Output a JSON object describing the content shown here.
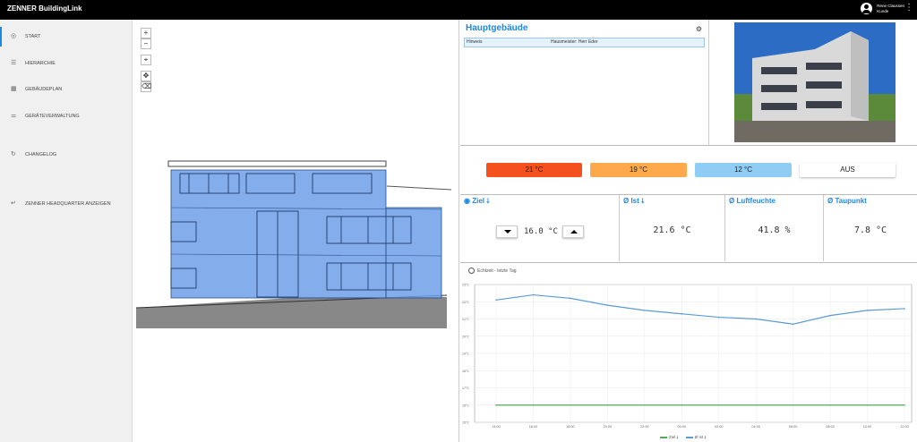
{
  "app": {
    "title": "ZENNER BuildingLink"
  },
  "user": {
    "name": "Rene Claussen",
    "role": "Kunde"
  },
  "sidebar": {
    "items": [
      {
        "label": "START",
        "icon": "dashboard-icon",
        "active": true
      },
      {
        "label": "HIERARCHIE",
        "icon": "hierarchy-icon"
      },
      {
        "label": "GEBÄUDEPLAN",
        "icon": "building-icon"
      },
      {
        "label": "GERÄTEVERWALTUNG",
        "icon": "sliders-icon"
      },
      {
        "label": "CHANGELOG",
        "icon": "history-icon"
      },
      {
        "label": "ZENNER HEADQUARTER ANZEIGEN",
        "icon": "return-icon"
      }
    ]
  },
  "map_controls": {
    "zoom_in": "+",
    "zoom_out": "−"
  },
  "building": {
    "title": "Hauptgebäude",
    "note_key": "Hinweis",
    "note_value": "Hausmeister: Herr Eder"
  },
  "temp_buttons": [
    {
      "label": "21 °C",
      "color": "#f4511e"
    },
    {
      "label": "19 °C",
      "color": "#ffa94d"
    },
    {
      "label": "12 °C",
      "color": "#90cdf4"
    },
    {
      "label": "AUS",
      "color": "#ffffff"
    }
  ],
  "kpis": {
    "ziel": {
      "title": "◉ Ziel ⭣",
      "value": "16.0 °C"
    },
    "ist": {
      "title": "Ø Ist ⭣",
      "value": "21.6 °C"
    },
    "feuchte": {
      "title": "Ø Luftfeuchte",
      "value": "41.8 %"
    },
    "taupunkt": {
      "title": "Ø Taupunkt",
      "value": "7.8 °C"
    }
  },
  "chart_label": "Echtzeit - letzte Tag",
  "chart_data": {
    "type": "line",
    "x": [
      "14:00",
      "16:00",
      "18:00",
      "20:00",
      "22:00",
      "00:00",
      "02:00",
      "04:00",
      "06:00",
      "08:00",
      "10:00",
      "12:00"
    ],
    "series": [
      {
        "name": "Ziel ⭣",
        "color": "#4caf50",
        "values": [
          16,
          16,
          16,
          16,
          16,
          16,
          16,
          16,
          16,
          16,
          16,
          16
        ]
      },
      {
        "name": "Ø Ist ⭣",
        "color": "#5b9bd5",
        "values": [
          22.1,
          22.4,
          22.2,
          21.8,
          21.5,
          21.3,
          21.1,
          21.0,
          20.7,
          21.2,
          21.5,
          21.6
        ]
      }
    ],
    "yticks": [
      "15°C",
      "16°C",
      "17°C",
      "18°C",
      "19°C",
      "20°C",
      "21°C",
      "22°C",
      "23°C"
    ],
    "ylim": [
      15,
      23
    ],
    "grid": true,
    "legend": "bottom"
  }
}
